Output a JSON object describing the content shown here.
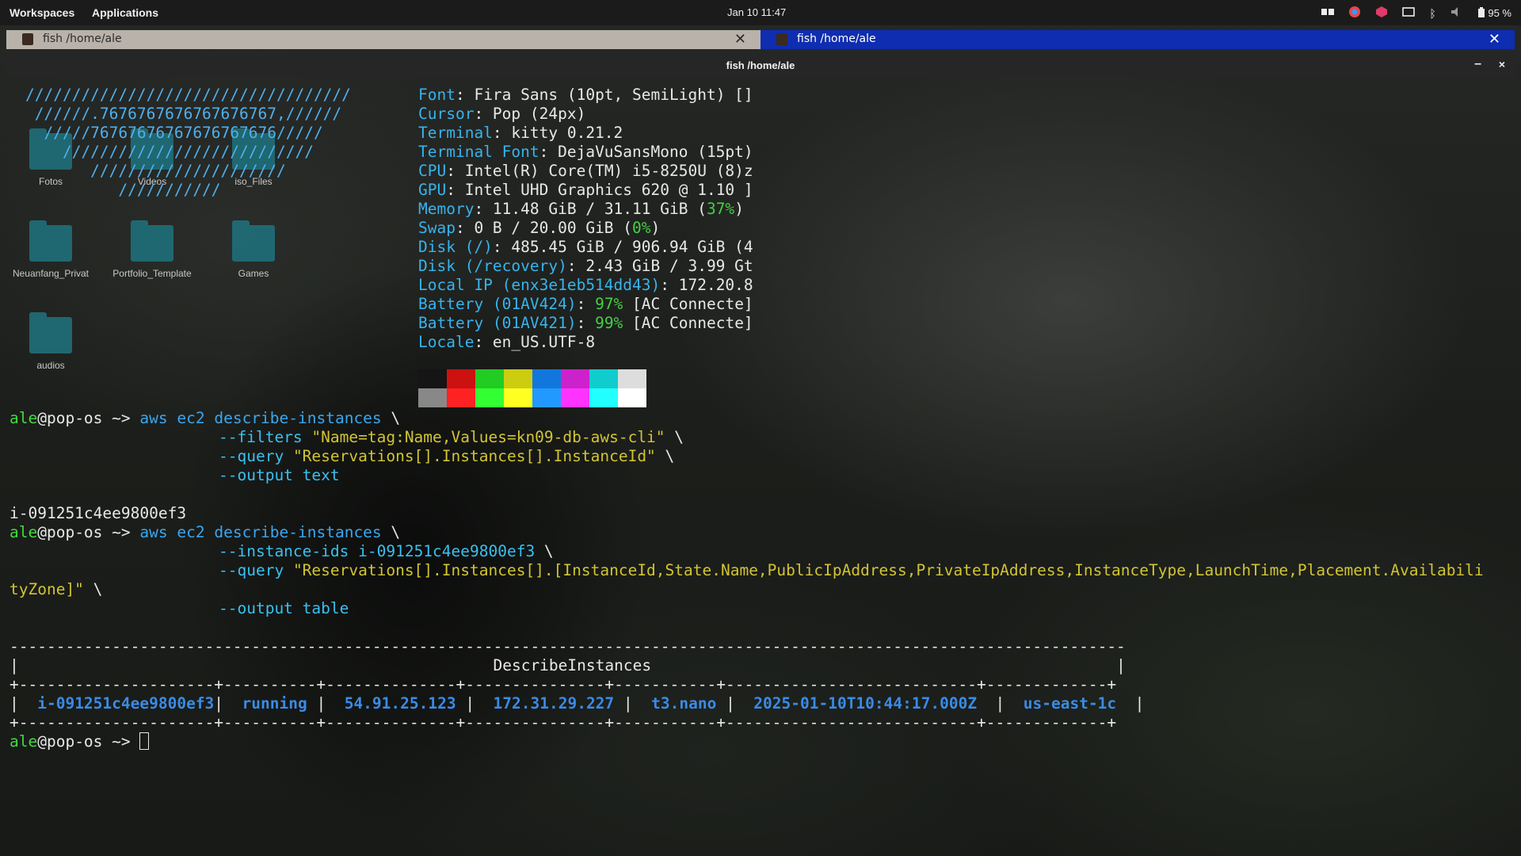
{
  "topbar": {
    "workspaces": "Workspaces",
    "applications": "Applications",
    "clock": "Jan 10  11:47",
    "battery": "95 %"
  },
  "tabs": [
    {
      "label": "fish /home/ale",
      "active": false
    },
    {
      "label": "fish /home/ale",
      "active": true
    }
  ],
  "window": {
    "title": "fish /home/ale",
    "minimize": "–",
    "close": "×"
  },
  "desktop_icons": [
    {
      "label": "Fotos"
    },
    {
      "label": "Videos"
    },
    {
      "label": "iso_Files"
    },
    {
      "label": "Neuanfang_Privat"
    },
    {
      "label": "Portfolio_Template"
    },
    {
      "label": "Games"
    },
    {
      "label": "audios"
    }
  ],
  "neofetch": {
    "logo": [
      "///////////////////////////////////",
      " //////.7676767676767676767,//////",
      "  /////76767676767676767676/////",
      "    ///////////////////////////",
      "       /////////////////////",
      "          ///////////"
    ],
    "info": [
      {
        "key": "Font",
        "value": ": Fira Sans (10pt, SemiLight) []"
      },
      {
        "key": "Cursor",
        "value": ": Pop (24px)"
      },
      {
        "key": "Terminal",
        "value": ": kitty 0.21.2"
      },
      {
        "key": "Terminal Font",
        "value": ": DejaVuSansMono (15pt)"
      },
      {
        "key": "CPU",
        "value": ": Intel(R) Core(TM) i5-8250U (8)z"
      },
      {
        "key": "GPU",
        "value": ": Intel UHD Graphics 620 @ 1.10 ]"
      },
      {
        "key": "Memory",
        "value": ": 11.48 GiB / 31.11 GiB (",
        "pct": "37%",
        "tail": ")"
      },
      {
        "key": "Swap",
        "value": ": 0 B / 20.00 GiB (",
        "pct": "0%",
        "tail": ")"
      },
      {
        "key": "Disk (/)",
        "value": ": 485.45 GiB / 906.94 GiB (4"
      },
      {
        "key": "Disk (/recovery)",
        "value": ": 2.43 GiB / 3.99 Gt"
      },
      {
        "key": "Local IP (enx3e1eb514dd43)",
        "value": ": 172.20.8"
      },
      {
        "key": "Battery (01AV424)",
        "value": ": ",
        "pct": "97%",
        "tail": " [AC Connecte]"
      },
      {
        "key": "Battery (01AV421)",
        "value": ": ",
        "pct": "99%",
        "tail": " [AC Connecte]"
      },
      {
        "key": "Locale",
        "value": ": en_US.UTF-8"
      }
    ],
    "palette_top": [
      "#141514",
      "#cc1111",
      "#22cc22",
      "#cccc11",
      "#1177dd",
      "#cc22cc",
      "#11cccc",
      "#dddddd"
    ],
    "palette_bottom": [
      "#888888",
      "#ff2222",
      "#33ff33",
      "#ffff22",
      "#2299ff",
      "#ff33ff",
      "#22ffff",
      "#ffffff"
    ]
  },
  "session": {
    "prompt_user": "ale",
    "prompt_rest": "@pop-os ~> ",
    "cmd1": {
      "aws": "aws",
      "ec2": "ec2",
      "sub": "describe-instances",
      "cont": " \\",
      "filters_flag": "--filters",
      "filters_val": "\"Name=tag:Name,Values=kn09-db-aws-cli\"",
      "query_flag": "--query",
      "query_val": "\"Reservations[].Instances[].InstanceId\"",
      "output_flag": "--output",
      "output_val": "text"
    },
    "result1": "i-091251c4ee9800ef3",
    "cmd2": {
      "aws": "aws",
      "ec2": "ec2",
      "sub": "describe-instances",
      "ids_flag": "--instance-ids",
      "ids_val": "i-091251c4ee9800ef3",
      "query_flag": "--query",
      "query_val": "\"Reservations[].Instances[].[InstanceId,State.Name,PublicIpAddress,PrivateIpAddress,InstanceType,LaunchTime,Placement.Availabili",
      "query_wrap": "tyZone]\"",
      "output_flag": "--output",
      "output_val": "table"
    },
    "table": {
      "title": "DescribeInstances",
      "row": {
        "instance_id": "i-091251c4ee9800ef3",
        "state": "running",
        "public_ip": "54.91.25.123",
        "private_ip": "172.31.29.227",
        "type": "t3.nano",
        "launch_time": "2025-01-10T10:44:17.000Z",
        "az": "us-east-1c"
      }
    }
  }
}
